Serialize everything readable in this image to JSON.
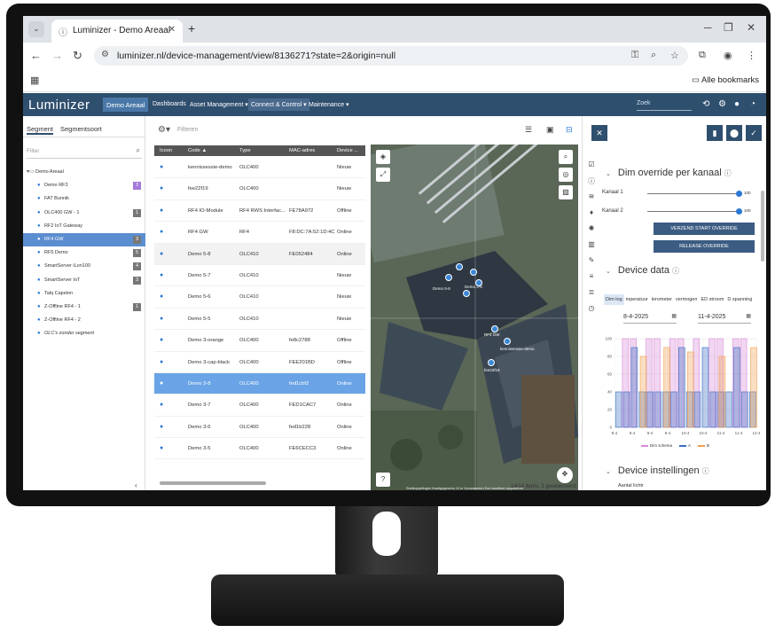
{
  "browser": {
    "tab_title": "Luminizer - Demo Areaal",
    "url": "luminizer.nl/device-management/view/8136271?state=2&origin=null",
    "bookmarks_label": "Alle bookmarks"
  },
  "app": {
    "logo": "Luminizer",
    "project": "Demo Areaal",
    "menu": [
      "Dashboards",
      "Asset Management ▾",
      "Connect & Control ▾",
      "Maintenance ▾"
    ],
    "search_placeholder": "Zoek"
  },
  "left": {
    "tabs": [
      "Segment",
      "Segmentsoort"
    ],
    "filter_placeholder": "Filter",
    "tree": [
      {
        "label": "Demo Areaal",
        "root": true
      },
      {
        "label": "Demo RF3",
        "badge": "3",
        "badge_color": "purple"
      },
      {
        "label": "FAT Bunnik"
      },
      {
        "label": "OLC400 GW - 1",
        "badge": "1"
      },
      {
        "label": "RF2 IoT Gateway"
      },
      {
        "label": "RF4 GW",
        "badge": "3",
        "selected": true
      },
      {
        "label": "RF5 Demo",
        "badge": "5"
      },
      {
        "label": "SmartServer iLon100",
        "badge": "4"
      },
      {
        "label": "SmartServer IoT",
        "badge": "3"
      },
      {
        "label": "Talq Capelon"
      },
      {
        "label": "Z-Offline RF4 - 1",
        "badge": "1"
      },
      {
        "label": "Z-Offline RF4 - 2"
      },
      {
        "label": "OLC's zonder segment",
        "italic": true
      }
    ]
  },
  "table": {
    "filter_placeholder": "Filteren",
    "headers": [
      "Icoon",
      "Code ▲",
      "Type",
      "MAC-adres",
      "Device ..."
    ],
    "rows": [
      {
        "code": "kennissessie-demo",
        "type": "OLC400",
        "mac": "",
        "status": "Nieuw"
      },
      {
        "code": "fee22f19",
        "type": "OLC400",
        "mac": "",
        "status": "Nieuw"
      },
      {
        "code": "RF4 IO-Module",
        "type": "RF4 RWS Interfac...",
        "mac": "FE78A972",
        "status": "Offline"
      },
      {
        "code": "RF4 GW",
        "type": "RF4",
        "mac": "F8:DC:7A:52:1D:4C",
        "status": "Online"
      },
      {
        "code": "Demo 5-8",
        "type": "OLC410",
        "mac": "FE052484",
        "status": "Online"
      },
      {
        "code": "Demo 5-7",
        "type": "OLC410",
        "mac": "",
        "status": "Nieuw"
      },
      {
        "code": "Demo 5-6",
        "type": "OLC410",
        "mac": "",
        "status": "Nieuw"
      },
      {
        "code": "Demo 5-5",
        "type": "OLC410",
        "mac": "",
        "status": "Nieuw"
      },
      {
        "code": "Demo 3-orange",
        "type": "OLC400",
        "mac": "fe8c2788",
        "status": "Offline"
      },
      {
        "code": "Demo 3-cap-black",
        "type": "OLC400",
        "mac": "FEE201BD",
        "status": "Offline"
      },
      {
        "code": "Demo 3-8",
        "type": "OLC400",
        "mac": "fed1cbf2",
        "status": "Online",
        "selected": true
      },
      {
        "code": "Demo 3-7",
        "type": "OLC400",
        "mac": "FED1CAC7",
        "status": "Online"
      },
      {
        "code": "Demo 3-6",
        "type": "OLC400",
        "mac": "fed1b228",
        "status": "Online"
      },
      {
        "code": "Demo 3-5",
        "type": "OLC400",
        "mac": "FE6CECC3",
        "status": "Online"
      }
    ],
    "footer": "14/14 items, 1 geselecteerd"
  },
  "map": {
    "labels": [
      "Demo 3-8",
      "RF4 GW",
      "kennissessie-demo",
      "fee22f19",
      "Demo 5-8"
    ],
    "attribution": "Snelkoppelingen   Kaartgegevens   10 m   Voorwaarden   Een kaartfout rapporteren"
  },
  "right": {
    "dim_title": "Dim override per kanaal",
    "kanaal1": "Kanaal 1",
    "kanaal2": "Kanaal 2",
    "k1_value": "100",
    "k2_value": "100",
    "k1_level": 1.0,
    "k2_level": 1.0,
    "btn_start": "VERZEND START OVERRIDE",
    "btn_release": "RELEASE OVERRIDE",
    "device_data_title": "Device data",
    "data_tabs": [
      "Dim log",
      "mperatuur",
      "lerometer",
      "vermogen",
      "ED stroom",
      "D spanning"
    ],
    "date_from": "8-4-2025",
    "date_to": "11-4-2025",
    "instellingen_title": "Device instellingen",
    "aantal_label": "Aantal lichtr"
  },
  "chart_data": {
    "type": "area",
    "title": "",
    "xlabel": "",
    "ylabel": "",
    "ylim": [
      0,
      100
    ],
    "y_ticks": [
      0,
      20,
      40,
      60,
      80,
      100
    ],
    "x_ticks": [
      "8-4",
      "8-4",
      "9-4",
      "9-4",
      "10-4",
      "10-4",
      "11-4",
      "11-4",
      "12-4"
    ],
    "series": [
      {
        "name": "Dim schema",
        "color": "#d88ad8",
        "values": [
          0,
          100,
          100,
          0,
          100,
          100,
          0,
          100,
          100,
          0,
          100,
          0,
          100,
          100,
          0,
          100,
          100,
          0
        ]
      },
      {
        "name": "A",
        "color": "#3b6fc4",
        "values": [
          40,
          40,
          90,
          40,
          40,
          40,
          40,
          40,
          90,
          40,
          40,
          90,
          40,
          40,
          40,
          90,
          40,
          40
        ]
      },
      {
        "name": "B",
        "color": "#f0a050",
        "values": [
          0,
          0,
          0,
          80,
          0,
          0,
          90,
          0,
          0,
          85,
          0,
          0,
          0,
          80,
          0,
          0,
          0,
          90
        ]
      }
    ],
    "legend_position": "bottom"
  }
}
